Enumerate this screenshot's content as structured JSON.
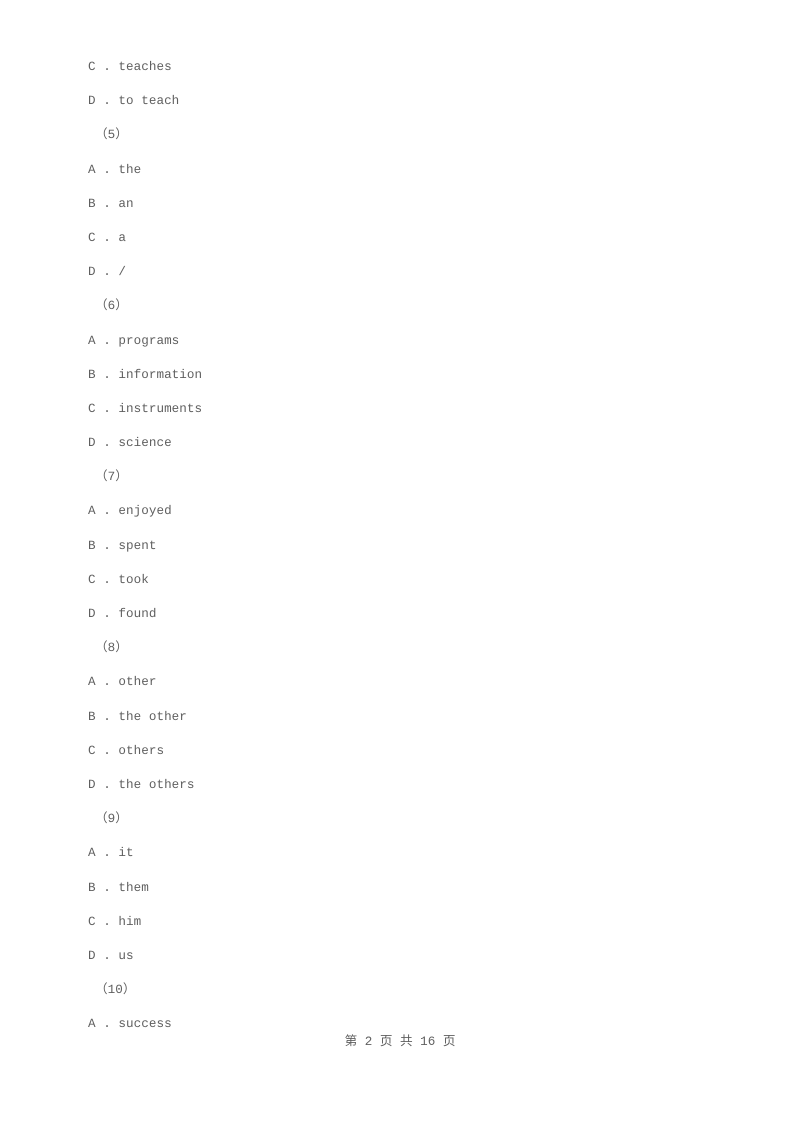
{
  "document": {
    "background_color": "#ffffff",
    "text_color": "#5f5f5f",
    "lines": [
      {
        "kind": "option",
        "text": "C . teaches"
      },
      {
        "kind": "option",
        "text": "D . to teach"
      },
      {
        "kind": "qnum",
        "text": "（5）"
      },
      {
        "kind": "option",
        "text": "A . the"
      },
      {
        "kind": "option",
        "text": "B . an"
      },
      {
        "kind": "option",
        "text": "C . a"
      },
      {
        "kind": "option",
        "text": "D . /"
      },
      {
        "kind": "qnum",
        "text": "（6）"
      },
      {
        "kind": "option",
        "text": "A . programs"
      },
      {
        "kind": "option",
        "text": "B . information"
      },
      {
        "kind": "option",
        "text": "C . instruments"
      },
      {
        "kind": "option",
        "text": "D . science"
      },
      {
        "kind": "qnum",
        "text": "（7）"
      },
      {
        "kind": "option",
        "text": "A . enjoyed"
      },
      {
        "kind": "option",
        "text": "B . spent"
      },
      {
        "kind": "option",
        "text": "C . took"
      },
      {
        "kind": "option",
        "text": "D . found"
      },
      {
        "kind": "qnum",
        "text": "（8）"
      },
      {
        "kind": "option",
        "text": "A . other"
      },
      {
        "kind": "option",
        "text": "B . the other"
      },
      {
        "kind": "option",
        "text": "C . others"
      },
      {
        "kind": "option",
        "text": "D . the others"
      },
      {
        "kind": "qnum",
        "text": "（9）"
      },
      {
        "kind": "option",
        "text": "A . it"
      },
      {
        "kind": "option",
        "text": "B . them"
      },
      {
        "kind": "option",
        "text": "C . him"
      },
      {
        "kind": "option",
        "text": "D . us"
      },
      {
        "kind": "qnum",
        "text": "（10）"
      },
      {
        "kind": "option",
        "text": "A . success"
      }
    ]
  },
  "footer": {
    "text": "第 2 页 共 16 页",
    "current_page": "2",
    "total_pages": "16"
  }
}
